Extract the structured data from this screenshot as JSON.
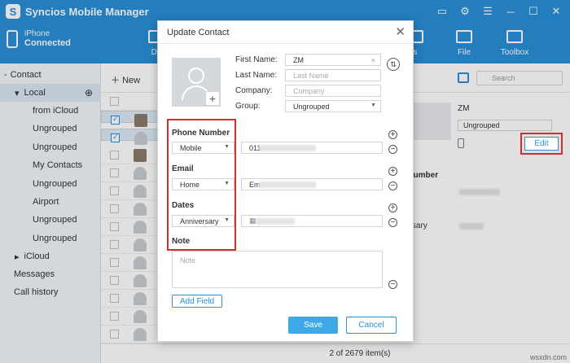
{
  "app": {
    "title": "Syncios Mobile Manager",
    "logo": "S"
  },
  "window_controls": [
    "message-icon",
    "gear-icon",
    "menu-icon",
    "minimize-icon",
    "maximize-icon",
    "close-icon"
  ],
  "device": {
    "name": "iPhone",
    "status": "Connected"
  },
  "topnav": [
    {
      "label": "De",
      "icon": "device-icon"
    },
    {
      "label": "s",
      "icon": "apps-icon"
    },
    {
      "label": "File",
      "icon": "folder-icon"
    },
    {
      "label": "Toolbox",
      "icon": "toolbox-icon"
    }
  ],
  "sidebar": {
    "items": [
      {
        "label": "Contact",
        "prefix": "-"
      },
      {
        "label": "Local",
        "prefix": "▾"
      },
      {
        "label": "from iCloud"
      },
      {
        "label": "Ungrouped"
      },
      {
        "label": "Ungrouped"
      },
      {
        "label": "My Contacts"
      },
      {
        "label": "Ungrouped"
      },
      {
        "label": "Airport"
      },
      {
        "label": "Ungrouped"
      },
      {
        "label": "Ungrouped"
      },
      {
        "label": "iCloud",
        "prefix": "▸"
      },
      {
        "label": "Messages"
      },
      {
        "label": "Call history"
      }
    ]
  },
  "toolbar": {
    "new_label": "New",
    "search_placeholder": "Search"
  },
  "detail": {
    "name": "ZM",
    "group": "Ungrouped",
    "edit_label": "Edit",
    "phone_label": "e Number",
    "phone_type": "ile",
    "date_label": "s",
    "date_type": "versary"
  },
  "footer": {
    "status": "2 of 2679 item(s)"
  },
  "dialog": {
    "title": "Update Contact",
    "fields": {
      "first_name_label": "First Name:",
      "first_name_value": "ZM",
      "last_name_label": "Last Name:",
      "last_name_placeholder": "Last Name",
      "company_label": "Company:",
      "company_placeholder": "Company",
      "group_label": "Group:",
      "group_value": "Ungrouped"
    },
    "phone": {
      "label": "Phone Number",
      "type": "Mobile",
      "value": "011"
    },
    "email": {
      "label": "Email",
      "type": "Home",
      "value": "Em"
    },
    "dates": {
      "label": "Dates",
      "type": "Anniversary"
    },
    "note": {
      "label": "Note",
      "placeholder": "Note"
    },
    "add_field_label": "Add Field",
    "save_label": "Save",
    "cancel_label": "Cancel"
  },
  "watermark": "wsxdn.com",
  "colors": {
    "accent": "#2a8fd6",
    "highlight": "#e0272a"
  }
}
